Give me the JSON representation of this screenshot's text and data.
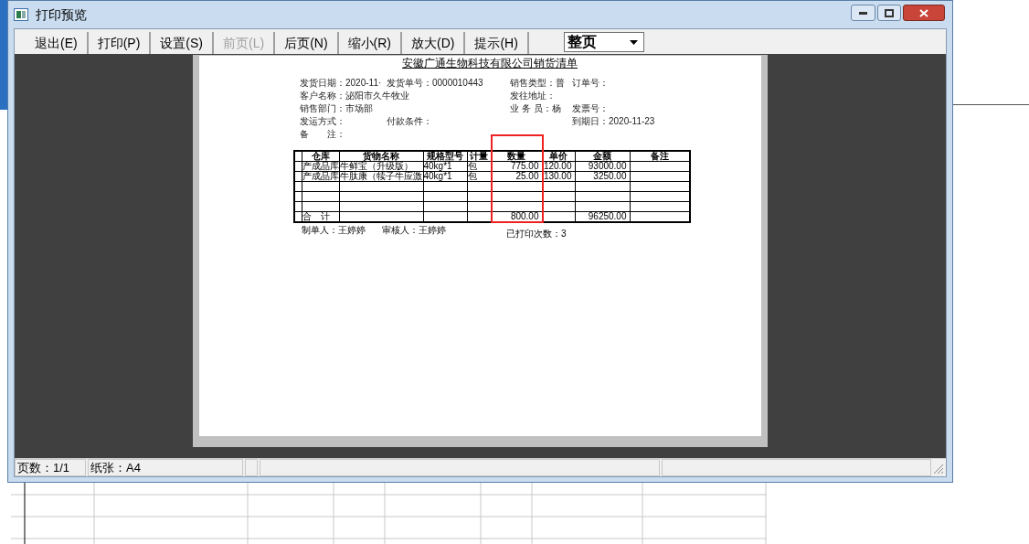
{
  "window": {
    "title": "打印预览"
  },
  "toolbar": [
    {
      "label": "退出(E)",
      "disabled": false
    },
    {
      "label": "打印(P)",
      "disabled": false
    },
    {
      "label": "设置(S)",
      "disabled": false
    },
    {
      "label": "前页(L)",
      "disabled": true
    },
    {
      "label": "后页(N)",
      "disabled": false
    },
    {
      "label": "缩小(R)",
      "disabled": false
    },
    {
      "label": "放大(D)",
      "disabled": false
    },
    {
      "label": "提示(H)",
      "disabled": false
    }
  ],
  "zoom_select": {
    "value": "整页"
  },
  "document": {
    "title": "安徽广通生物科技有限公司销货清单",
    "field_rows": [
      {
        "column_1": "发货日期：2020-11·",
        "column_2": "发货单号：0000010443",
        "column_3": "销售类型：普",
        "column_4": "订单号："
      },
      {
        "column_1": "客户名称：泌阳市久牛牧业",
        "column_3": "发往地址："
      },
      {
        "column_1": "销售部门：市场部",
        "column_3": "业 务 员：杨",
        "column_4": "发票号："
      },
      {
        "column_1": "发运方式：",
        "column_2": "付款条件：",
        "column_4": "到期日：2020-11-23"
      },
      {
        "column_1": "备　　注："
      }
    ],
    "table": {
      "columns": [
        "",
        "仓库",
        "货物名称",
        "规格型号",
        "计量",
        "数量",
        "单价",
        "金额",
        "备注"
      ],
      "rows": [
        [
          "",
          "产成品库",
          "牛鲜宝（升级版）",
          "40kg*1",
          "包",
          "775.00",
          "120.00",
          "93000.00",
          ""
        ],
        [
          "",
          "产成品库",
          "牛肽康（犊子牛应激",
          "40kg*1",
          "包",
          "25.00",
          "130.00",
          "3250.00",
          ""
        ],
        [
          "",
          "",
          "",
          "",
          "",
          "",
          "",
          "",
          ""
        ],
        [
          "",
          "",
          "",
          "",
          "",
          "",
          "",
          "",
          ""
        ],
        [
          "",
          "",
          "",
          "",
          "",
          "",
          "",
          "",
          ""
        ],
        [
          "",
          "合　计",
          "",
          "",
          "",
          "800.00",
          "",
          "96250.00",
          ""
        ]
      ]
    },
    "footer": {
      "maker": "制单人：王婷婷",
      "reviewer": "审核人：王婷婷",
      "print_count": "已打印次数：3"
    }
  },
  "status_bar": {
    "pages": "页数：1/1",
    "paper": "纸张：A4"
  }
}
